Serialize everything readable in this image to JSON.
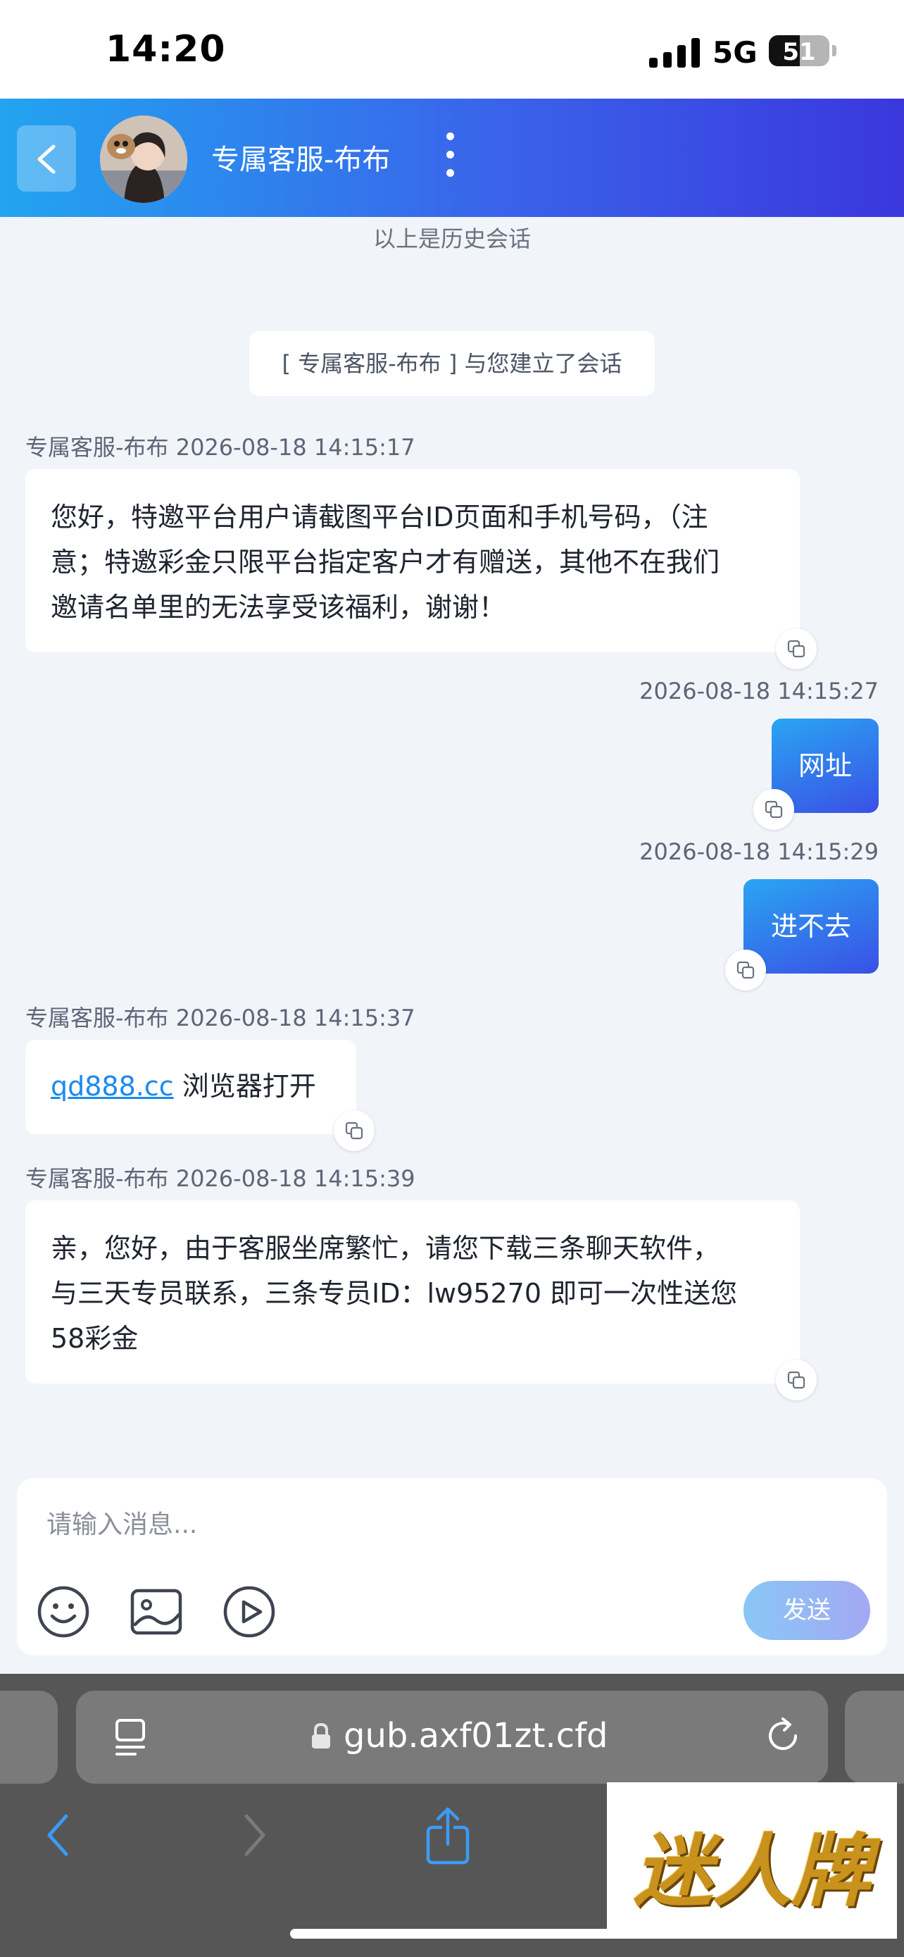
{
  "status_bar": {
    "time": "14:20",
    "network": "5G",
    "battery": "51",
    "battery_level": 0.51
  },
  "header": {
    "title": "专属客服-布布"
  },
  "chat": {
    "history_note": "以上是历史会话",
    "system_message": "[ 专属客服-布布 ] 与您建立了会话",
    "messages": [
      {
        "side": "left",
        "meta": "专属客服-布布 2026-08-18 14:15:17",
        "lines": [
          "您好，特邀平台用户请截图平台ID页面和手机号码，（注",
          "意；特邀彩金只限平台指定客户才有赠送，其他不在我们",
          "邀请名单里的无法享受该福利，谢谢！"
        ]
      },
      {
        "side": "right",
        "meta": "2026-08-18 14:15:27",
        "text": "网址"
      },
      {
        "side": "right",
        "meta": "2026-08-18 14:15:29",
        "text": "进不去"
      },
      {
        "side": "left",
        "meta": "专属客服-布布 2026-08-18 14:15:37",
        "link": "qd888.cc",
        "text": " 浏览器打开"
      },
      {
        "side": "left",
        "meta": "专属客服-布布 2026-08-18 14:15:39",
        "lines": [
          "亲，您好，由于客服坐席繁忙，请您下载三条聊天软件，",
          "与三天专员联系，三条专员ID：lw95270 即可一次性送您",
          "58彩金"
        ]
      }
    ]
  },
  "input": {
    "placeholder": "请输入消息...",
    "value": "",
    "send_label": "发送"
  },
  "browser": {
    "url": "gub.axf01zt.cfd"
  },
  "watermark": {
    "text": "迷人牌"
  },
  "colors": {
    "header_start": "#22a4f0",
    "header_end": "#3a37dd",
    "link": "#1a8af0",
    "send_button": "#89c7f5"
  },
  "icons": [
    "back-chevron-icon",
    "more-vertical-icon",
    "copy-icon",
    "emoji-icon",
    "image-icon",
    "video-play-icon",
    "page-menu-icon",
    "lock-icon",
    "reload-icon",
    "nav-back-icon",
    "nav-forward-icon",
    "share-icon"
  ]
}
